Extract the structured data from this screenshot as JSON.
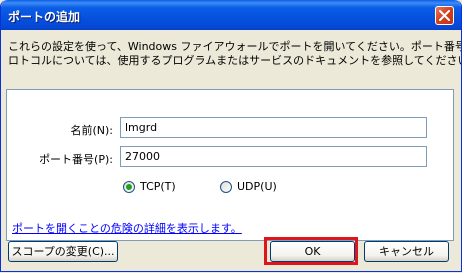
{
  "window": {
    "title": "ポートの追加"
  },
  "description": {
    "line1": "これらの設定を使って、Windows ファイアウォールでポートを開いてください。ポート番号およびプ",
    "line2": "ロトコルについては、使用するプログラムまたはサービスのドキュメントを参照してください。"
  },
  "form": {
    "name_label": "名前(N):",
    "name_value": "lmgrd",
    "port_label": "ポート番号(P):",
    "port_value": "27000",
    "tcp_label": "TCP(T)",
    "udp_label": "UDP(U)",
    "selected_protocol": "TCP"
  },
  "risk_link": "ポートを開くことの危険の詳細を表示します。",
  "buttons": {
    "scope": "スコープの変更(C)...",
    "ok": "OK",
    "cancel": "キャンセル"
  },
  "colors": {
    "titlebar": "#0551df",
    "highlight": "#e0141c",
    "link": "#0000ff",
    "radio_selected": "#21a121"
  }
}
